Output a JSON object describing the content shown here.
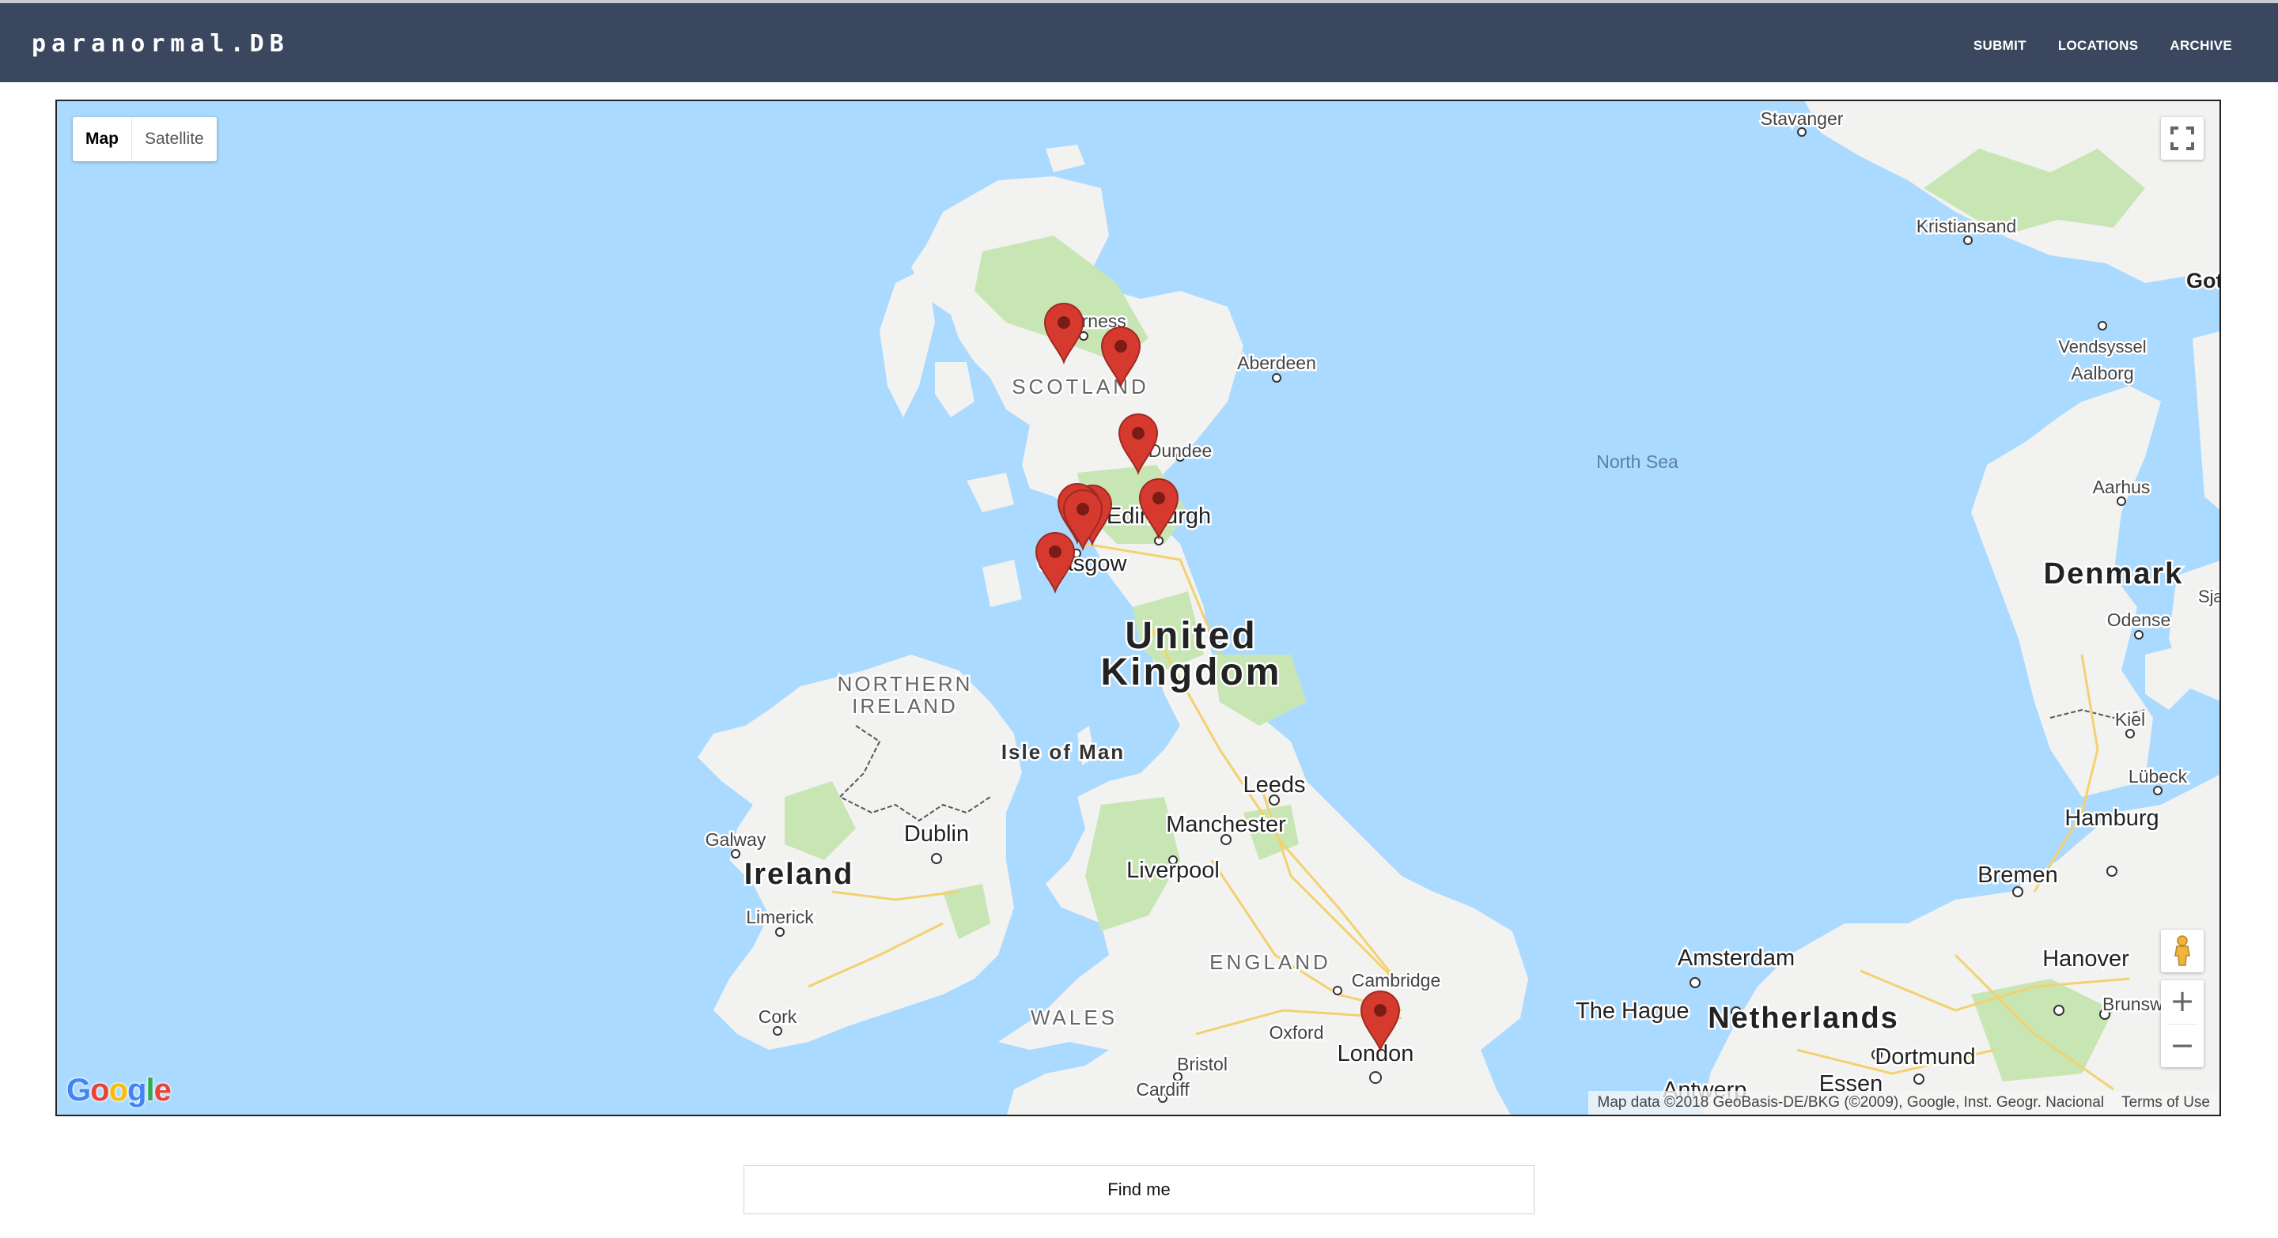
{
  "nav": {
    "brand": "paranormal.DB",
    "links": [
      "SUBMIT",
      "LOCATIONS",
      "ARCHIVE"
    ]
  },
  "map": {
    "type_controls": {
      "map": "Map",
      "satellite": "Satellite",
      "selected": "Map"
    },
    "logo": "Google",
    "attribution": "Map data ©2018 GeoBasis-DE/BKG (©2009), Google, Inst. Geogr. Nacional",
    "terms": "Terms of Use",
    "zoom_in": "+",
    "zoom_out": "−",
    "colors": {
      "water": "#aadaff",
      "land": "#f2f2f0",
      "park": "#c8e6b4",
      "marker": "#d63a2f",
      "border": "#555555"
    },
    "labels": [
      "Stavanger",
      "Kristiansand",
      "Got",
      "Vendsyssel",
      "Aalborg",
      "Aarhus",
      "Denmark",
      "Sjæ",
      "Odense",
      "Kiel",
      "Lübeck",
      "Hamburg",
      "Bremen",
      "Hanover",
      "Brunsw",
      "Amsterdam",
      "The Hague",
      "Netherlands",
      "Dortmund",
      "Essen",
      "Antwerp",
      "North Sea",
      "SCOTLAND",
      "Inverness",
      "Aberdeen",
      "Dundee",
      "Edinburgh",
      "Glasgow",
      "United",
      "Kingdom",
      "NORTHERN",
      "IRELAND",
      "Isle of Man",
      "Galway",
      "Dublin",
      "Ireland",
      "Limerick",
      "Cork",
      "Leeds",
      "Manchester",
      "Liverpool",
      "ENGLAND",
      "WALES",
      "Cambridge",
      "Oxford",
      "London",
      "Bristol",
      "Cardiff"
    ],
    "marker_count": 10
  },
  "find_me": "Find me"
}
